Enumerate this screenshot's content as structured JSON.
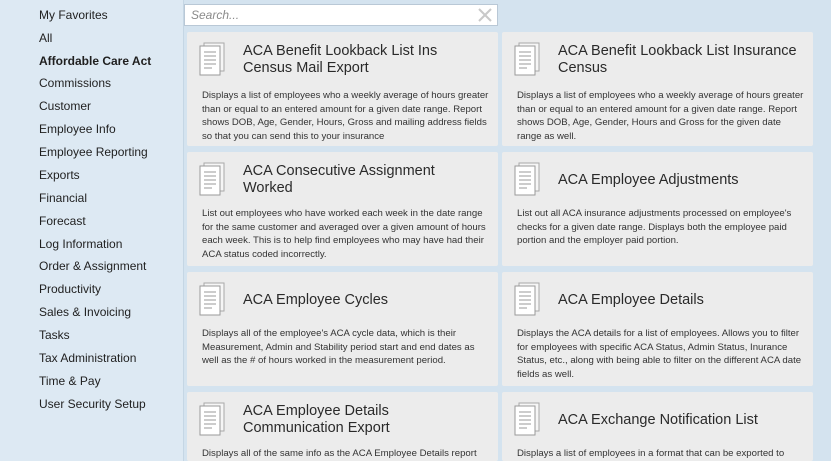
{
  "sidebar": {
    "items": [
      {
        "label": "My Favorites",
        "active": false
      },
      {
        "label": "All",
        "active": false
      },
      {
        "label": "Affordable Care Act",
        "active": true
      },
      {
        "label": "Commissions",
        "active": false
      },
      {
        "label": "Customer",
        "active": false
      },
      {
        "label": "Employee Info",
        "active": false
      },
      {
        "label": "Employee Reporting",
        "active": false
      },
      {
        "label": "Exports",
        "active": false
      },
      {
        "label": "Financial",
        "active": false
      },
      {
        "label": "Forecast",
        "active": false
      },
      {
        "label": "Log Information",
        "active": false
      },
      {
        "label": "Order & Assignment",
        "active": false
      },
      {
        "label": "Productivity",
        "active": false
      },
      {
        "label": "Sales & Invoicing",
        "active": false
      },
      {
        "label": "Tasks",
        "active": false
      },
      {
        "label": "Tax Administration",
        "active": false
      },
      {
        "label": "Time & Pay",
        "active": false
      },
      {
        "label": "User Security Setup",
        "active": false
      }
    ]
  },
  "search": {
    "placeholder": "Search..."
  },
  "reports": [
    {
      "title": "ACA Benefit Lookback List Ins Census Mail Export",
      "description": "Displays a list of employees who a weekly average of hours greater than or equal to an entered amount for a given date range.  Report shows DOB, Age, Gender, Hours, Gross and mailing address fields so that you can send this to your insurance"
    },
    {
      "title": "ACA Benefit Lookback List Insurance Census",
      "description": "Displays a list of employees who a weekly average of hours greater than or equal to an entered amount for a given date range.  Report shows DOB, Age, Gender, Hours and Gross for the given date range as well."
    },
    {
      "title": "ACA Consecutive Assignment Worked",
      "description": "List out employees who have worked each week in the date range for the same customer and averaged over a given amount of hours each week.  This is to help find employees who may have had their ACA status coded incorrectly."
    },
    {
      "title": "ACA Employee Adjustments",
      "description": "List out all ACA insurance adjustments processed on employee's checks for a given date range.  Displays both the employee paid portion and the employer paid portion."
    },
    {
      "title": "ACA Employee Cycles",
      "description": "Displays all of the employee's ACA cycle data, which is their Measurement, Admin and Stability period start and end dates as well as the # of hours worked in the measurement period."
    },
    {
      "title": "ACA Employee Details",
      "description": "Displays the ACA details for a list of employees.  Allows you to filter for employees with specific ACA Status, Admin Status, Inurance Status, etc., along with being able to filter on the different ACA date fields as well."
    },
    {
      "title": "ACA Employee Details Communication Export",
      "description": "Displays all of the same info as the ACA Employee Details report"
    },
    {
      "title": "ACA Exchange Notification List",
      "description": "Displays a list of employees in a format that can be exported to"
    }
  ],
  "colors": {
    "sidebar_bg": "#dde9f3",
    "main_bg": "#d4e3ef",
    "card_bg": "#ececec"
  },
  "icons": {
    "report": "document-icon",
    "clear": "close-icon"
  }
}
